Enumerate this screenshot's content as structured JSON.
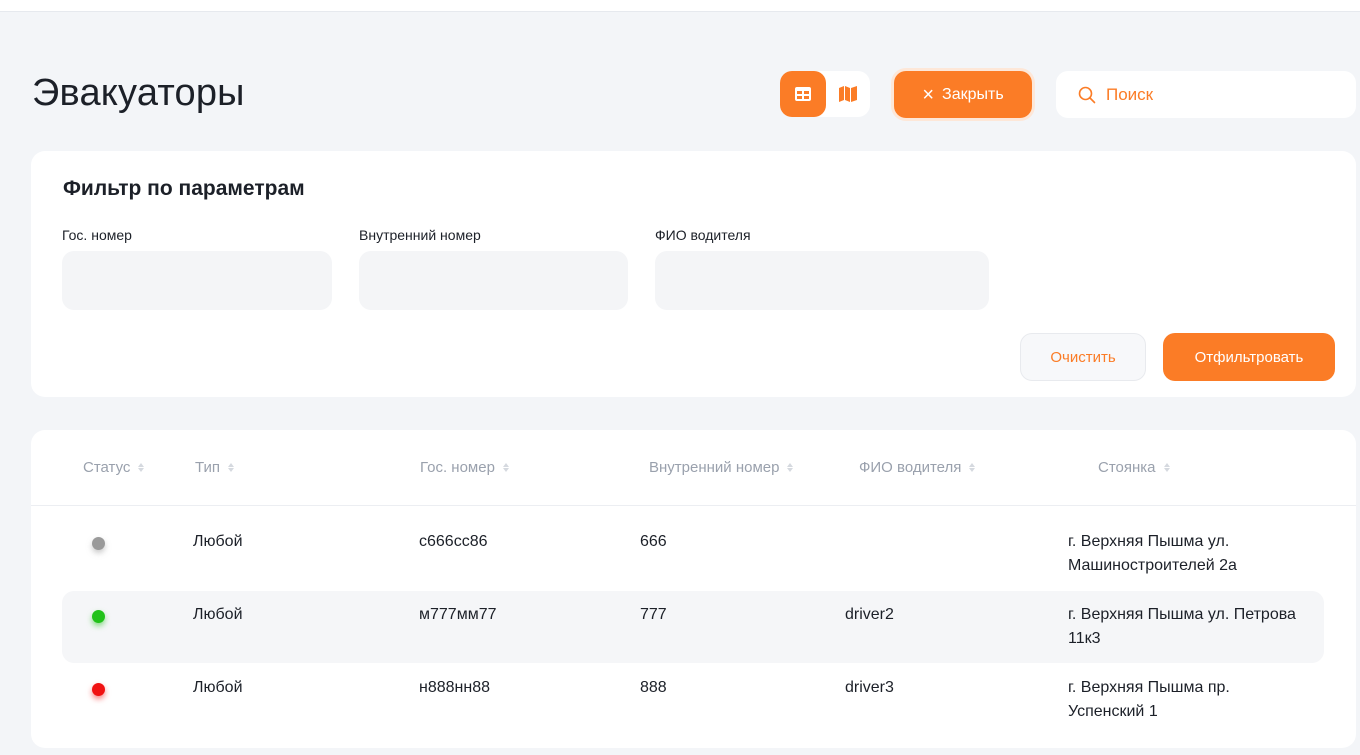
{
  "page": {
    "title": "Эвакуаторы"
  },
  "toolbar": {
    "view_table_icon": "table-grid-icon",
    "view_map_icon": "map-icon",
    "close_label": "Закрыть",
    "search_placeholder": "Поиск",
    "accent_color": "#fb7c26"
  },
  "filter": {
    "title": "Фильтр по параметрам",
    "fields": [
      {
        "label": "Гос. номер",
        "value": ""
      },
      {
        "label": "Внутренний номер",
        "value": ""
      },
      {
        "label": "ФИО водителя",
        "value": ""
      }
    ],
    "clear_label": "Очистить",
    "apply_label": "Отфильтровать"
  },
  "table": {
    "columns": [
      "Статус",
      "Тип",
      "Гос. номер",
      "Внутренний номер",
      "ФИО водителя",
      "Стоянка"
    ],
    "rows": [
      {
        "status_color": "#9a9a9a",
        "type": "Любой",
        "plate": "с666сс86",
        "internal": "666",
        "driver": "",
        "parking": "г. Верхняя Пышма ул. Машиностроителей 2а"
      },
      {
        "status_color": "#22c21a",
        "type": "Любой",
        "plate": "м777мм77",
        "internal": "777",
        "driver": "driver2",
        "parking": "г. Верхняя Пышма ул. Петрова 11к3"
      },
      {
        "status_color": "#f01212",
        "type": "Любой",
        "plate": "н888нн88",
        "internal": "888",
        "driver": "driver3",
        "parking": "г. Верхняя Пышма пр. Успенский 1"
      }
    ]
  }
}
